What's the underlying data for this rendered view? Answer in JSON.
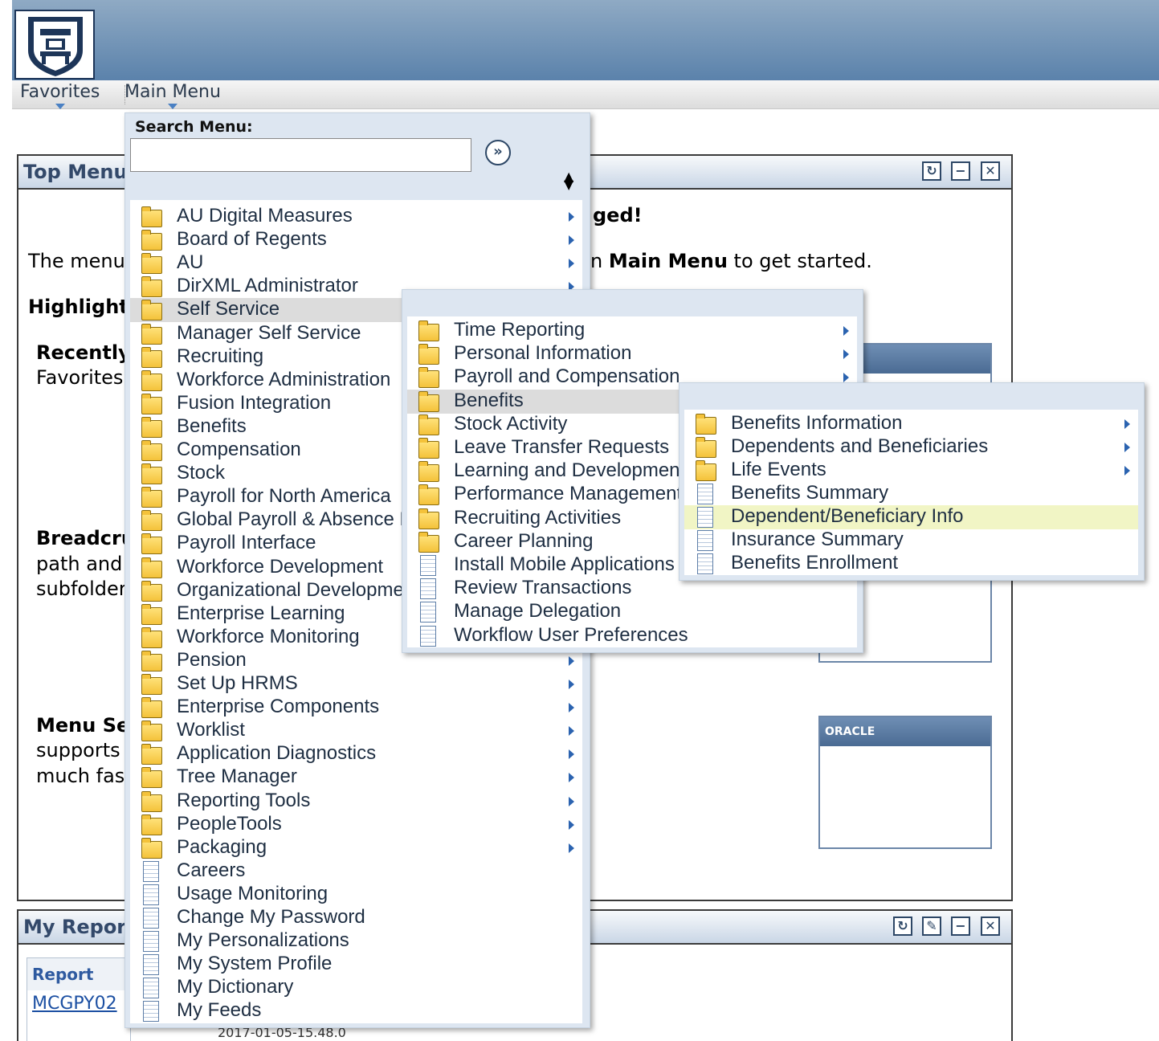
{
  "nav": {
    "favorites": "Favorites",
    "main_menu": "Main Menu"
  },
  "search": {
    "label": "Search Menu:",
    "placeholder": ""
  },
  "top_menu": {
    "title": "Top Menu",
    "welcome_tail": "ged!",
    "intro_left": "The menu",
    "intro_right_prefix": "n ",
    "intro_right_bold": "Main Menu",
    "intro_right_suffix": " to get started.",
    "highlights": "Highlight:",
    "recently": "Recently",
    "favorites_text": "Favorites",
    "breadcrumbs": "Breadcru",
    "path_and": "path and",
    "subfolder": "subfolder",
    "menu_se": "Menu Se",
    "supports": "supports",
    "much_fast": "much fas"
  },
  "thumbs": {
    "oracle": "ORACLE"
  },
  "my_reports": {
    "title": "My Report",
    "col_report": "Report",
    "row1": "MCGPY02",
    "row1_date": "2017-01-05-15.48.0"
  },
  "main_menu_items": [
    {
      "label": "AU Digital Measures",
      "type": "folder",
      "sub": true
    },
    {
      "label": "Board of Regents",
      "type": "folder",
      "sub": true
    },
    {
      "label": "AU",
      "type": "folder",
      "sub": true
    },
    {
      "label": "DirXML Administrator",
      "type": "folder",
      "sub": true
    },
    {
      "label": "Self Service",
      "type": "folder",
      "sub": true
    },
    {
      "label": "Manager Self Service",
      "type": "folder",
      "sub": true
    },
    {
      "label": "Recruiting",
      "type": "folder",
      "sub": true
    },
    {
      "label": "Workforce Administration",
      "type": "folder",
      "sub": true
    },
    {
      "label": "Fusion Integration",
      "type": "folder",
      "sub": true
    },
    {
      "label": "Benefits",
      "type": "folder",
      "sub": true
    },
    {
      "label": "Compensation",
      "type": "folder",
      "sub": true
    },
    {
      "label": "Stock",
      "type": "folder",
      "sub": true
    },
    {
      "label": "Payroll for North America",
      "type": "folder",
      "sub": true
    },
    {
      "label": "Global Payroll & Absence M",
      "type": "folder",
      "sub": true
    },
    {
      "label": "Payroll Interface",
      "type": "folder",
      "sub": true
    },
    {
      "label": "Workforce Development",
      "type": "folder",
      "sub": true
    },
    {
      "label": "Organizational Developme",
      "type": "folder",
      "sub": true
    },
    {
      "label": "Enterprise Learning",
      "type": "folder",
      "sub": true
    },
    {
      "label": "Workforce Monitoring",
      "type": "folder",
      "sub": true
    },
    {
      "label": "Pension",
      "type": "folder",
      "sub": true
    },
    {
      "label": "Set Up HRMS",
      "type": "folder",
      "sub": true
    },
    {
      "label": "Enterprise Components",
      "type": "folder",
      "sub": true
    },
    {
      "label": "Worklist",
      "type": "folder",
      "sub": true
    },
    {
      "label": "Application Diagnostics",
      "type": "folder",
      "sub": true
    },
    {
      "label": "Tree Manager",
      "type": "folder",
      "sub": true
    },
    {
      "label": "Reporting Tools",
      "type": "folder",
      "sub": true
    },
    {
      "label": "PeopleTools",
      "type": "folder",
      "sub": true
    },
    {
      "label": "Packaging",
      "type": "folder",
      "sub": true
    },
    {
      "label": "Careers",
      "type": "doc",
      "sub": false
    },
    {
      "label": "Usage Monitoring",
      "type": "doc",
      "sub": false
    },
    {
      "label": "Change My Password",
      "type": "doc",
      "sub": false
    },
    {
      "label": "My Personalizations",
      "type": "doc",
      "sub": false
    },
    {
      "label": "My System Profile",
      "type": "doc",
      "sub": false
    },
    {
      "label": "My Dictionary",
      "type": "doc",
      "sub": false
    },
    {
      "label": "My Feeds",
      "type": "doc",
      "sub": false
    }
  ],
  "self_service_items": [
    {
      "label": "Time Reporting",
      "type": "folder",
      "sub": true
    },
    {
      "label": "Personal Information",
      "type": "folder",
      "sub": true
    },
    {
      "label": "Payroll and Compensation",
      "type": "folder",
      "sub": true
    },
    {
      "label": "Benefits",
      "type": "folder",
      "sub": true
    },
    {
      "label": "Stock Activity",
      "type": "folder",
      "sub": true
    },
    {
      "label": "Leave Transfer Requests",
      "type": "folder",
      "sub": true
    },
    {
      "label": "Learning and Development",
      "type": "folder",
      "sub": true
    },
    {
      "label": "Performance Management",
      "type": "folder",
      "sub": true
    },
    {
      "label": "Recruiting Activities",
      "type": "folder",
      "sub": true
    },
    {
      "label": "Career Planning",
      "type": "folder",
      "sub": true
    },
    {
      "label": "Install Mobile Applications",
      "type": "doc",
      "sub": false
    },
    {
      "label": "Review Transactions",
      "type": "doc",
      "sub": false
    },
    {
      "label": "Manage Delegation",
      "type": "doc",
      "sub": false
    },
    {
      "label": "Workflow User Preferences",
      "type": "doc",
      "sub": false
    }
  ],
  "benefits_items": [
    {
      "label": "Benefits Information",
      "type": "folder",
      "sub": true
    },
    {
      "label": "Dependents and Beneficiaries",
      "type": "folder",
      "sub": true
    },
    {
      "label": "Life Events",
      "type": "folder",
      "sub": true
    },
    {
      "label": "Benefits Summary",
      "type": "doc",
      "sub": false
    },
    {
      "label": "Dependent/Beneficiary Info",
      "type": "doc",
      "sub": false
    },
    {
      "label": "Insurance Summary",
      "type": "doc",
      "sub": false
    },
    {
      "label": "Benefits Enrollment",
      "type": "doc",
      "sub": false
    }
  ]
}
